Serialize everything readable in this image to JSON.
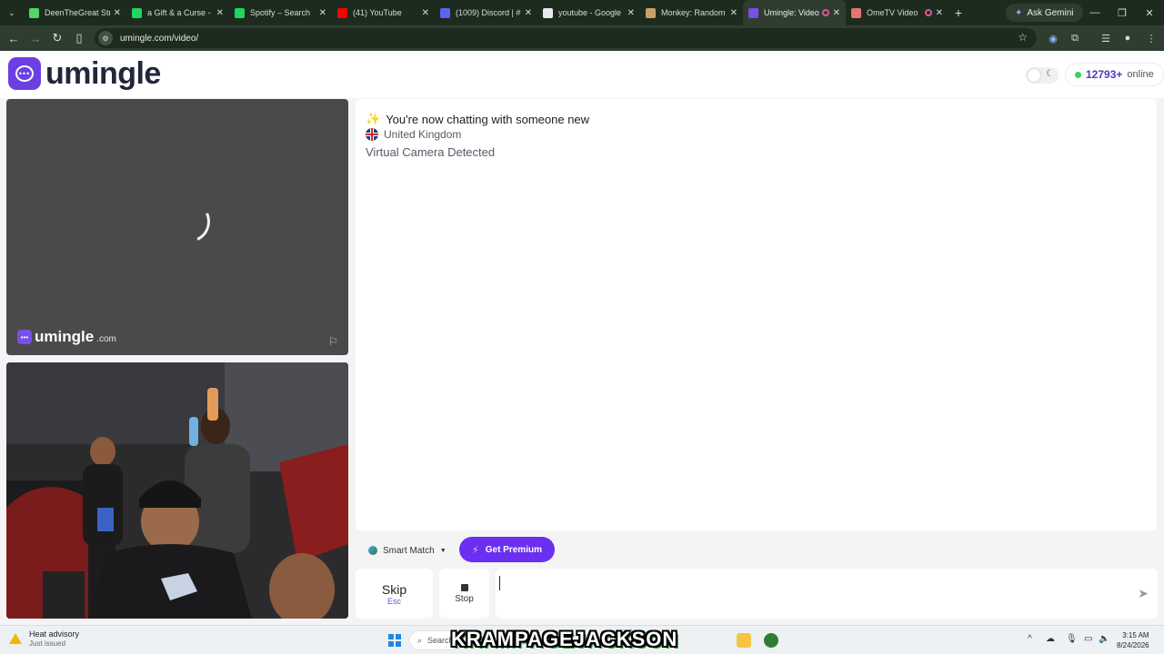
{
  "browser": {
    "tabs": [
      {
        "label": "DeenTheGreat Str",
        "color": "#53d769",
        "icon": "kick-icon"
      },
      {
        "label": "a Gift & a Curse -",
        "color": "#1ed760",
        "icon": "spotify-icon"
      },
      {
        "label": "Spotify – Search",
        "color": "#1ed760",
        "icon": "spotify-icon"
      },
      {
        "label": "(41) YouTube",
        "color": "#ff0000",
        "icon": "youtube-icon"
      },
      {
        "label": "(1009) Discord | #",
        "color": "#5865f2",
        "icon": "discord-icon"
      },
      {
        "label": "youtube - Google",
        "color": "#e8eaed",
        "icon": "google-icon"
      },
      {
        "label": "Monkey: Random",
        "color": "#c8a16a",
        "icon": "monkey-icon"
      },
      {
        "label": "Umingle: Video",
        "color": "#7a4fe8",
        "icon": "umingle-icon",
        "active": true
      },
      {
        "label": "OmeTV Video",
        "color": "#e57373",
        "icon": "ometv-icon"
      }
    ],
    "gemini_label": "Ask Gemini",
    "url": "umingle.com/video/"
  },
  "site": {
    "logo_text": "umingle",
    "online_count": "12793+",
    "online_label": "online",
    "watermark_name": "umingle",
    "watermark_domain": ".com"
  },
  "chat": {
    "status_emoji": "✨",
    "status_text": "You're now chatting with someone new",
    "country": "United Kingdom",
    "camera_notice": "Virtual Camera Detected"
  },
  "controls": {
    "smart_match_label": "Smart Match",
    "premium_label": "Get Premium",
    "skip_label": "Skip",
    "skip_hint": "Esc",
    "stop_label": "Stop",
    "message_value": "",
    "accent_color": "#6a2ff0"
  },
  "taskbar": {
    "weather_title": "Heat advisory",
    "weather_sub": "Just issued",
    "search_label": "Search",
    "overlay_name": "KRAMPAGEJACKSON",
    "time": "3:15 AM",
    "date": "8/24/2026"
  }
}
